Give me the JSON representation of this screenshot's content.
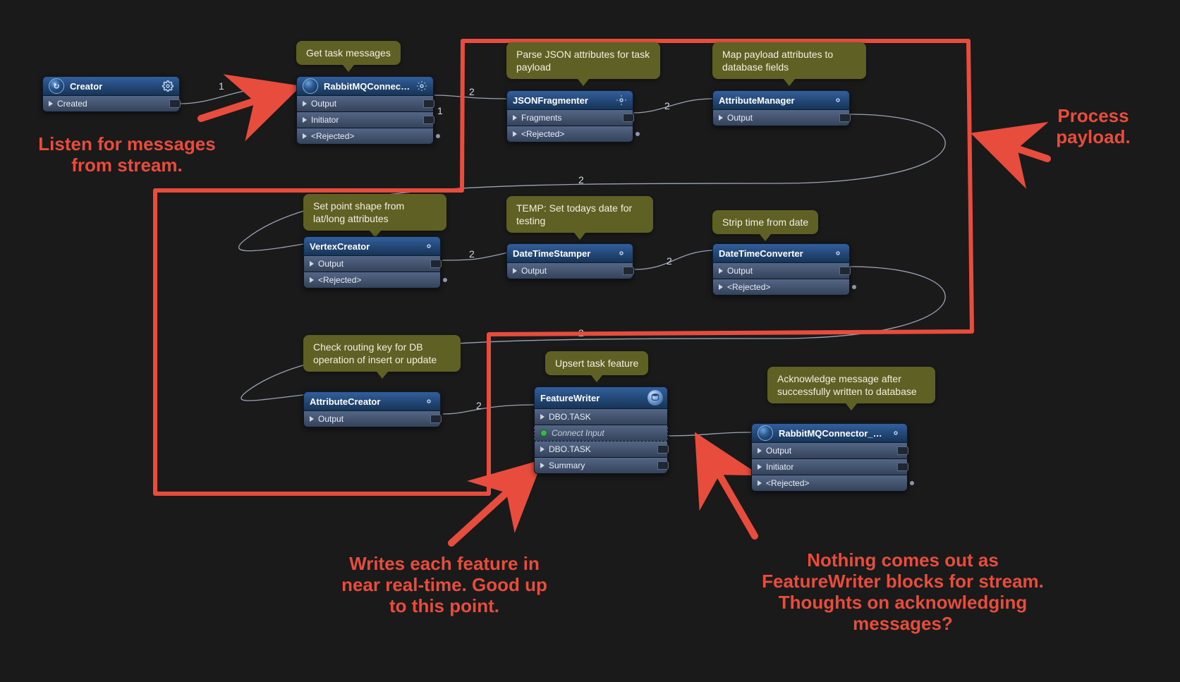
{
  "tooltips": {
    "rabbitmq_main": "Get task messages",
    "json_fragmenter": "Parse JSON attributes for task payload",
    "attribute_manager": "Map payload attributes to database fields",
    "vertex_creator": "Set point shape from lat/long attributes",
    "datetime_stamper": "TEMP: Set todays date for testing",
    "datetime_converter": "Strip time from date",
    "attribute_creator": "Check routing key for DB operation of insert or update",
    "feature_writer": "Upsert task feature",
    "rabbitmq_ack": "Acknowledge message after successfully written to database"
  },
  "nodes": {
    "creator": {
      "title": "Creator",
      "ports": {
        "created": "Created"
      }
    },
    "rabbitmq_main": {
      "title": "RabbitMQConnector",
      "ports": {
        "output": "Output",
        "initiator": "Initiator",
        "rejected": "<Rejected>"
      }
    },
    "json_fragmenter": {
      "title": "JSONFragmenter",
      "ports": {
        "fragments": "Fragments",
        "rejected": "<Rejected>"
      }
    },
    "attribute_manager": {
      "title": "AttributeManager",
      "ports": {
        "output": "Output"
      }
    },
    "vertex_creator": {
      "title": "VertexCreator",
      "ports": {
        "output": "Output",
        "rejected": "<Rejected>"
      }
    },
    "datetime_stamper": {
      "title": "DateTimeStamper",
      "ports": {
        "output": "Output"
      }
    },
    "datetime_converter": {
      "title": "DateTimeConverter",
      "ports": {
        "output": "Output",
        "rejected": "<Rejected>"
      }
    },
    "attribute_creator": {
      "title": "AttributeCreator",
      "ports": {
        "output": "Output"
      }
    },
    "feature_writer": {
      "title": "FeatureWriter",
      "ports": {
        "dbo_task_in": "DBO.TASK",
        "connect_input": "Connect Input",
        "dbo_task_out": "DBO.TASK",
        "summary": "Summary"
      }
    },
    "rabbitmq_ack": {
      "title": "RabbitMQConnector_Ack",
      "ports": {
        "output": "Output",
        "initiator": "Initiator",
        "rejected": "<Rejected>"
      }
    }
  },
  "edge_counts": {
    "creator_to_rabbit": "1",
    "rabbit_initiator": "1",
    "rabbit_to_json": "2",
    "json_to_attrmgr": "2",
    "attrmgr_to_vertex": "2",
    "vertex_to_dtstamp": "2",
    "dtstamp_to_dtconv": "2",
    "dtconv_to_attrcreate": "2",
    "attrcreate_to_fwriter": "2"
  },
  "annotations": {
    "listen": "Listen for messages from stream.",
    "process_payload": "Process payload.",
    "writes_realtime": "Writes each feature in near real-time. Good up to this point.",
    "nothing_out": "Nothing comes out as FeatureWriter blocks for stream. Thoughts on acknowledging messages?"
  }
}
